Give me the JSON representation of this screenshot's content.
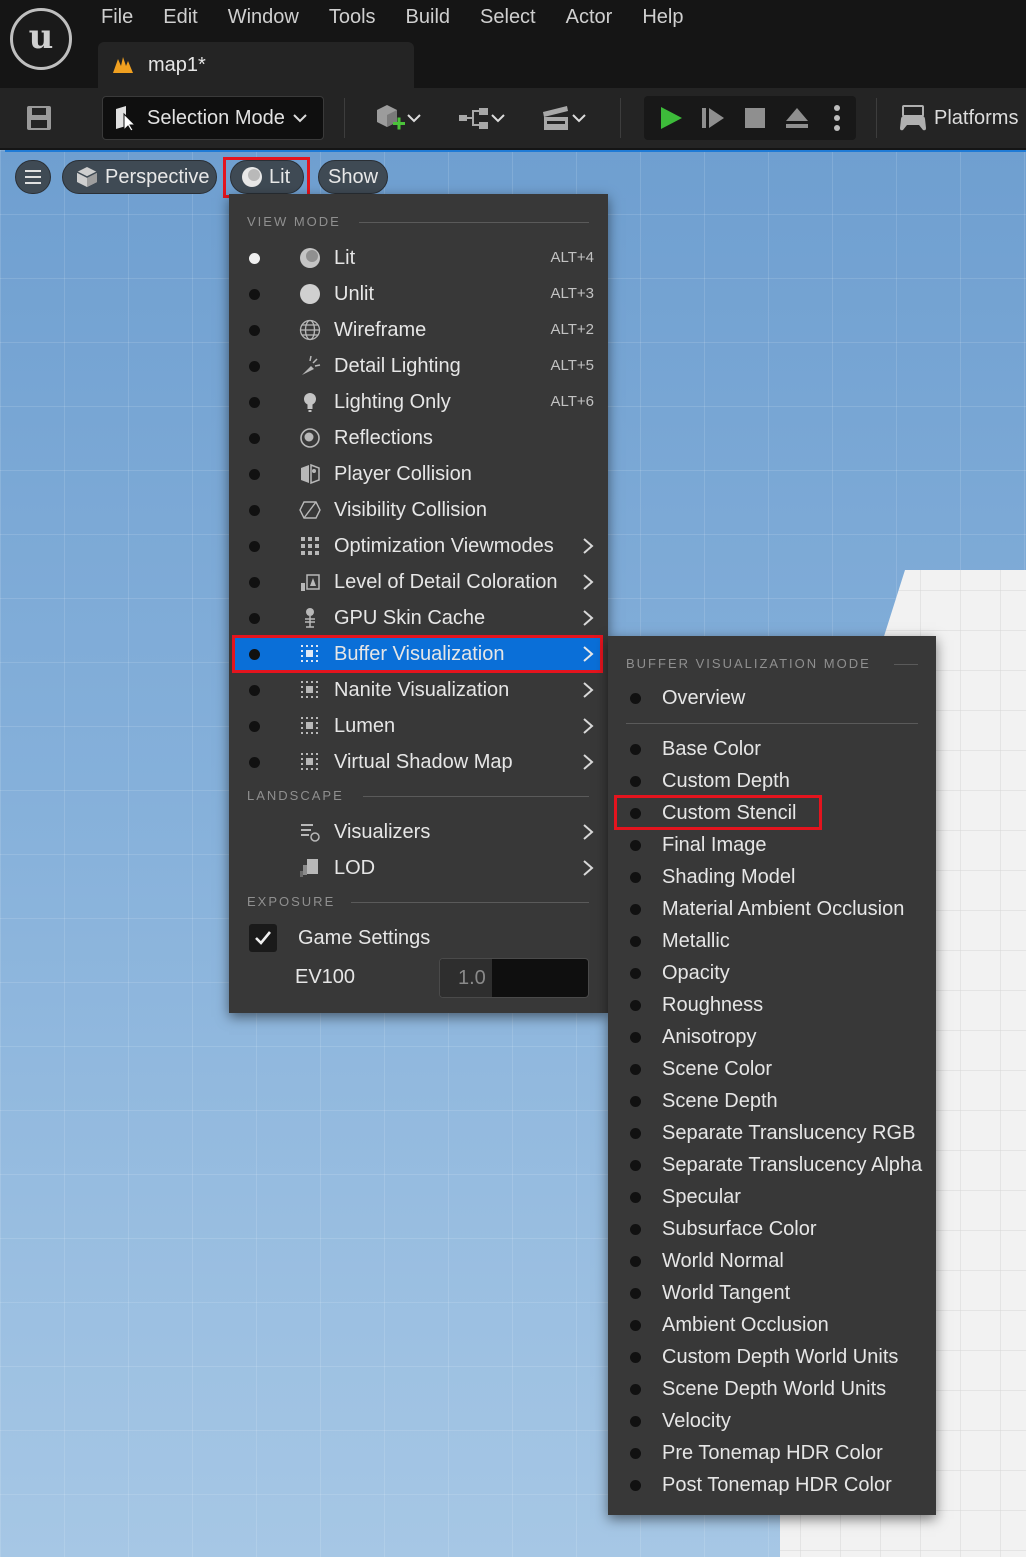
{
  "menu": [
    "File",
    "Edit",
    "Window",
    "Tools",
    "Build",
    "Select",
    "Actor",
    "Help"
  ],
  "document_tab": {
    "label": "map1*"
  },
  "toolbar": {
    "selection_mode": "Selection Mode",
    "platforms": "Platforms"
  },
  "viewport": {
    "perspective": "Perspective",
    "lit": "Lit",
    "show": "Show"
  },
  "view_mode_menu": {
    "header": "VIEW MODE",
    "items": [
      {
        "label": "Lit",
        "shortcut": "ALT+4",
        "icon": "lit-sphere-icon",
        "selected": true
      },
      {
        "label": "Unlit",
        "shortcut": "ALT+3",
        "icon": "unlit-sphere-icon"
      },
      {
        "label": "Wireframe",
        "shortcut": "ALT+2",
        "icon": "wireframe-globe-icon"
      },
      {
        "label": "Detail Lighting",
        "shortcut": "ALT+5",
        "icon": "detail-lighting-icon"
      },
      {
        "label": "Lighting Only",
        "shortcut": "ALT+6",
        "icon": "lightbulb-icon"
      },
      {
        "label": "Reflections",
        "shortcut": "",
        "icon": "reflections-icon"
      },
      {
        "label": "Player Collision",
        "shortcut": "",
        "icon": "player-collision-icon"
      },
      {
        "label": "Visibility Collision",
        "shortcut": "",
        "icon": "visibility-collision-icon"
      },
      {
        "label": "Optimization Viewmodes",
        "shortcut": "",
        "icon": "optimization-grid-icon",
        "submenu": true
      },
      {
        "label": "Level of Detail Coloration",
        "shortcut": "",
        "icon": "lod-coloration-icon",
        "submenu": true
      },
      {
        "label": "GPU Skin Cache",
        "shortcut": "",
        "icon": "skeleton-icon",
        "submenu": true
      },
      {
        "label": "Buffer Visualization",
        "shortcut": "",
        "icon": "buffer-grid-icon",
        "submenu": true,
        "active": true
      },
      {
        "label": "Nanite Visualization",
        "shortcut": "",
        "icon": "nanite-grid-icon",
        "submenu": true
      },
      {
        "label": "Lumen",
        "shortcut": "",
        "icon": "lumen-grid-icon",
        "submenu": true
      },
      {
        "label": "Virtual Shadow Map",
        "shortcut": "",
        "icon": "vsm-grid-icon",
        "submenu": true
      }
    ],
    "landscape_header": "LANDSCAPE",
    "landscape_items": [
      {
        "label": "Visualizers",
        "icon": "visualizers-icon"
      },
      {
        "label": "LOD",
        "icon": "lod-icon"
      }
    ],
    "exposure_header": "EXPOSURE",
    "game_settings": {
      "label": "Game Settings",
      "checked": true
    },
    "ev100": {
      "label": "EV100",
      "value": "1.0",
      "fill": 0.35
    }
  },
  "buffer_menu": {
    "header": "BUFFER VISUALIZATION MODE",
    "overview": "Overview",
    "items": [
      "Base Color",
      "Custom Depth",
      "Custom Stencil",
      "Final Image",
      "Shading Model",
      "Material Ambient Occlusion",
      "Metallic",
      "Opacity",
      "Roughness",
      "Anisotropy",
      "Scene Color",
      "Scene Depth",
      "Separate Translucency RGB",
      "Separate Translucency Alpha",
      "Specular",
      "Subsurface Color",
      "World Normal",
      "World Tangent",
      "Ambient Occlusion",
      "Custom Depth World Units",
      "Scene Depth World Units",
      "Velocity",
      "Pre Tonemap HDR Color",
      "Post Tonemap HDR Color"
    ],
    "highlighted": "Custom Stencil"
  },
  "colors": {
    "accent": "#0a6fd8",
    "highlight_box": "#e4141e",
    "play_green": "#3dbb3a",
    "menu_bg": "#383838"
  }
}
